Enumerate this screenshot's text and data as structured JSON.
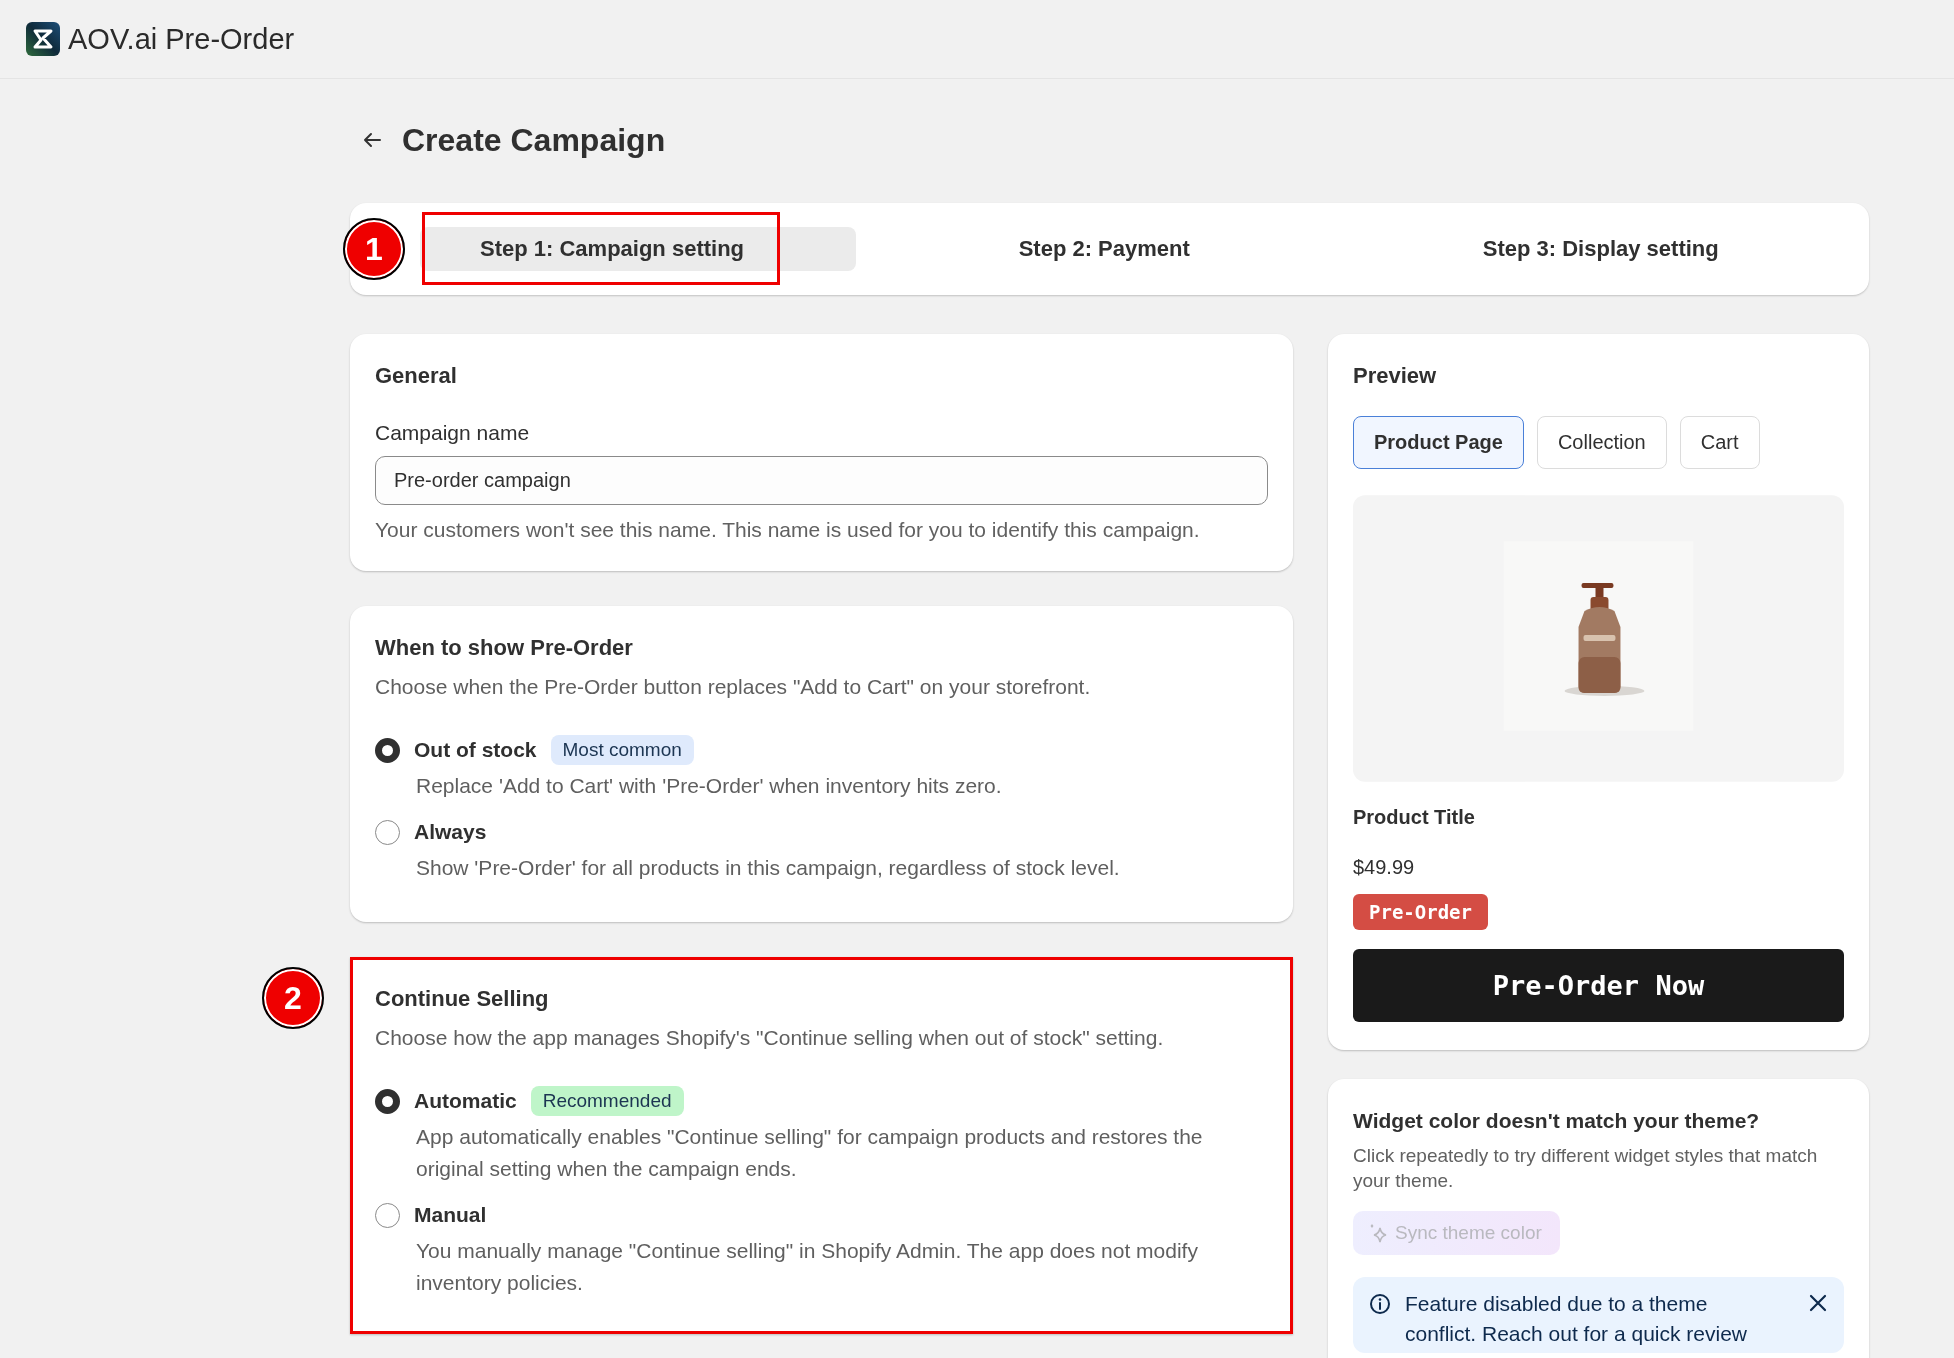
{
  "app": {
    "title": "AOV.ai Pre-Order"
  },
  "page": {
    "title": "Create Campaign"
  },
  "steps": [
    {
      "label": "Step 1: Campaign setting",
      "selected": true,
      "callout": "1"
    },
    {
      "label": "Step 2: Payment",
      "selected": false
    },
    {
      "label": "Step 3: Display setting",
      "selected": false
    }
  ],
  "general": {
    "title": "General",
    "field": {
      "label": "Campaign name",
      "value": "Pre-order campaign",
      "help": "Your customers won't see this name. This name is used for you to identify this campaign."
    }
  },
  "sections": [
    {
      "title": "When to show Pre-Order",
      "description": "Choose when the Pre-Order button replaces \"Add to Cart\" on your storefront.",
      "options": [
        {
          "label": "Out of stock",
          "badge": {
            "text": "Most common",
            "color": "#dfeafc"
          },
          "description": "Replace 'Add to Cart' with 'Pre-Order' when inventory hits zero.",
          "selected": true
        },
        {
          "label": "Always",
          "description": "Show 'Pre-Order' for all products in this campaign, regardless of stock level.",
          "selected": false
        }
      ]
    },
    {
      "title": "Continue Selling",
      "callout": "2",
      "description": "Choose how the app manages Shopify's \"Continue selling when out of stock\" setting.",
      "options": [
        {
          "label": "Automatic",
          "badge": {
            "text": "Recommended",
            "color": "#bff5c9"
          },
          "description": "App automatically enables \"Continue selling\" for campaign products and restores the original setting when the campaign ends.",
          "selected": true
        },
        {
          "label": "Manual",
          "description": "You manually manage \"Continue selling\" in Shopify Admin. The app does not modify inventory policies.",
          "selected": false
        }
      ]
    }
  ],
  "preview": {
    "title": "Preview",
    "tabs": [
      {
        "label": "Product Page",
        "selected": true
      },
      {
        "label": "Collection",
        "selected": false
      },
      {
        "label": "Cart",
        "selected": false
      }
    ],
    "product_title": "Product Title",
    "price": "$49.99",
    "badge": "Pre-Order",
    "button": "Pre-Order Now"
  },
  "widget": {
    "title": "Widget color doesn't match your theme?",
    "description": "Click repeatedly to try different widget styles that match your theme.",
    "button": {
      "label": "Sync theme color",
      "disabled": true
    },
    "banner": {
      "text": "Feature disabled due to a theme conflict. Reach out for a quick review"
    }
  }
}
